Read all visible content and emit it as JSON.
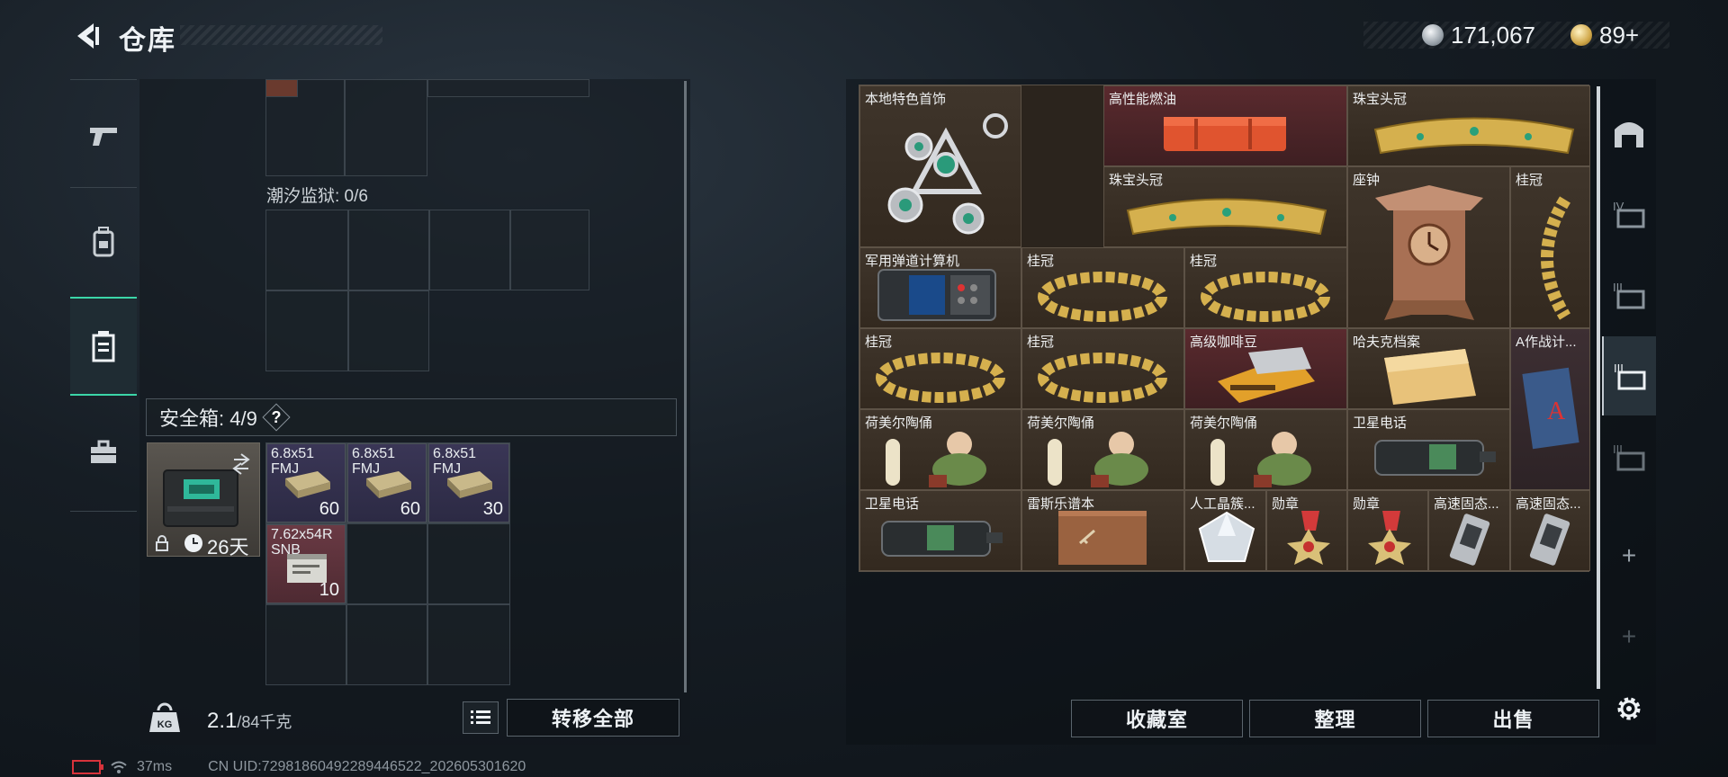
{
  "header": {
    "title": "仓库",
    "currency_silver": "171,067",
    "currency_gold": "89+"
  },
  "left_panel": {
    "tidal_prison_label": "潮汐监狱: 0/6",
    "safe_box_label": "安全箱: 4/9",
    "help_label": "?",
    "safe_box_timer": "26天",
    "items": [
      {
        "name": "6.8x51 FMJ",
        "qty": "60"
      },
      {
        "name": "6.8x51 FMJ",
        "qty": "60"
      },
      {
        "name": "6.8x51 FMJ",
        "qty": "30"
      },
      {
        "name": "7.62x54R SNB",
        "qty": "10"
      }
    ],
    "weight_current": "2.1",
    "weight_max": "/84千克",
    "transfer_all_label": "转移全部"
  },
  "stash": {
    "items": [
      {
        "name": "本地特色首饰"
      },
      {
        "name": "高性能燃油"
      },
      {
        "name": "珠宝头冠"
      },
      {
        "name": "珠宝头冠"
      },
      {
        "name": "座钟"
      },
      {
        "name": "桂冠"
      },
      {
        "name": "军用弹道计算机"
      },
      {
        "name": "桂冠"
      },
      {
        "name": "桂冠"
      },
      {
        "name": "桂冠"
      },
      {
        "name": "桂冠"
      },
      {
        "name": "高级咖啡豆"
      },
      {
        "name": "哈夫克档案"
      },
      {
        "name": "A作战计..."
      },
      {
        "name": "荷美尔陶俑"
      },
      {
        "name": "荷美尔陶俑"
      },
      {
        "name": "荷美尔陶俑"
      },
      {
        "name": "卫星电话"
      },
      {
        "name": "卫星电话"
      },
      {
        "name": "雷斯乐谱本"
      },
      {
        "name": "人工晶簇..."
      },
      {
        "name": "勋章"
      },
      {
        "name": "勋章"
      },
      {
        "name": "高速固态..."
      },
      {
        "name": "高速固态..."
      }
    ],
    "buttons": {
      "collection": "收藏室",
      "organize": "整理",
      "sell": "出售"
    }
  },
  "right_sidebar": {
    "tab_labels": [
      "IV",
      "III",
      "III",
      "III"
    ],
    "add_label": "+"
  },
  "status": {
    "ping": "37ms",
    "uid": "CN UID:7298186049228944652​2_202605301620"
  }
}
